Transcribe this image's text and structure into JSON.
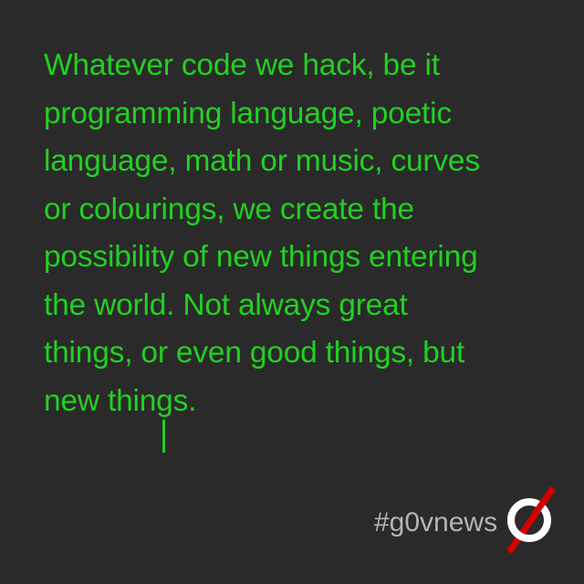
{
  "quote": {
    "text": "Whatever code we hack, be it\nprogramming language, poetic\nlanguage, math or music, curves\nor colourings, we create the\npossibility of new things entering\nthe world. Not always great\nthings, or even good things, but\nnew things."
  },
  "footer": {
    "hashtag": "#g0vnews",
    "logo_icon": "g0v-ring-slash-logo"
  },
  "colors": {
    "background": "#2a2a2a",
    "quote_text": "#22d022",
    "hashtag_text": "#b4b4b4",
    "logo_ring": "#ffffff",
    "logo_slash": "#d40000"
  }
}
